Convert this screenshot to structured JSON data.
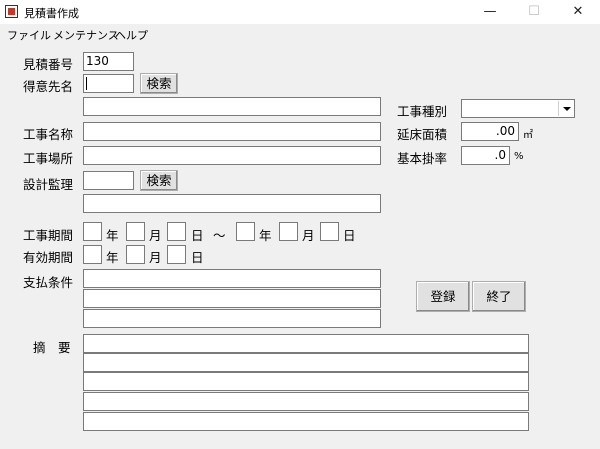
{
  "window": {
    "title": "見積書作成",
    "minimize": "—",
    "maximize": "☐",
    "close": "✕"
  },
  "menu": [
    "ファイル",
    "メンテナンス",
    "ヘルプ"
  ],
  "form": {
    "estimate_no_label": "見積番号",
    "estimate_no_value": "130",
    "customer_label": "得意先名",
    "search_label": "検索",
    "work_type_label": "工事種別",
    "work_name_label": "工事名称",
    "floor_area_label": "延床面積",
    "floor_area_value": ".00",
    "floor_area_unit": "㎡",
    "work_location_label": "工事場所",
    "base_rate_label": "基本掛率",
    "base_rate_value": ".0",
    "base_rate_unit": "%",
    "design_supervision_label": "設計監理",
    "work_period_label": "工事期間",
    "valid_period_label": "有効期間",
    "year": "年",
    "month": "月",
    "day": "日",
    "tilde": "～",
    "payment_terms_label": "支払条件",
    "summary_label": "摘　要",
    "register_label": "登録",
    "finish_label": "終了"
  }
}
